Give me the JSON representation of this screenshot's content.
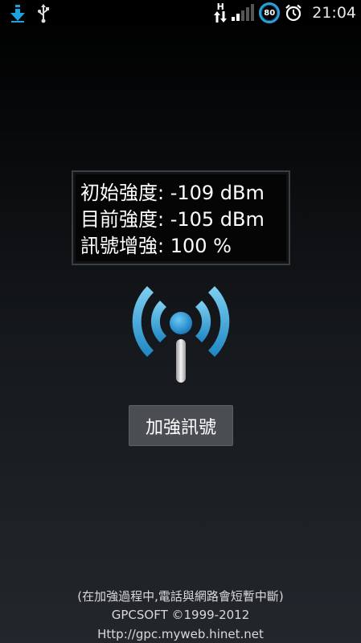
{
  "status_bar": {
    "time": "21:04",
    "battery_level": "80",
    "data_indicator": "H",
    "icons": [
      "download-icon",
      "usb-icon",
      "data-arrows-icon",
      "signal-icon",
      "battery-icon",
      "alarm-icon"
    ]
  },
  "info": {
    "initial_strength": "初始強度: -109 dBm",
    "current_strength": "目前強度: -105 dBm",
    "signal_boost": "訊號增強: 100 %"
  },
  "boost_button_label": "加強訊號",
  "footer": {
    "note": "(在加強過程中,電話與網路會短暫中斷)",
    "copyright": "GPCSOFT ©1999-2012",
    "url": "Http://gpc.myweb.hinet.net"
  },
  "colors": {
    "accent": "#2a9fd8",
    "button_bg": "#4a4d51"
  }
}
